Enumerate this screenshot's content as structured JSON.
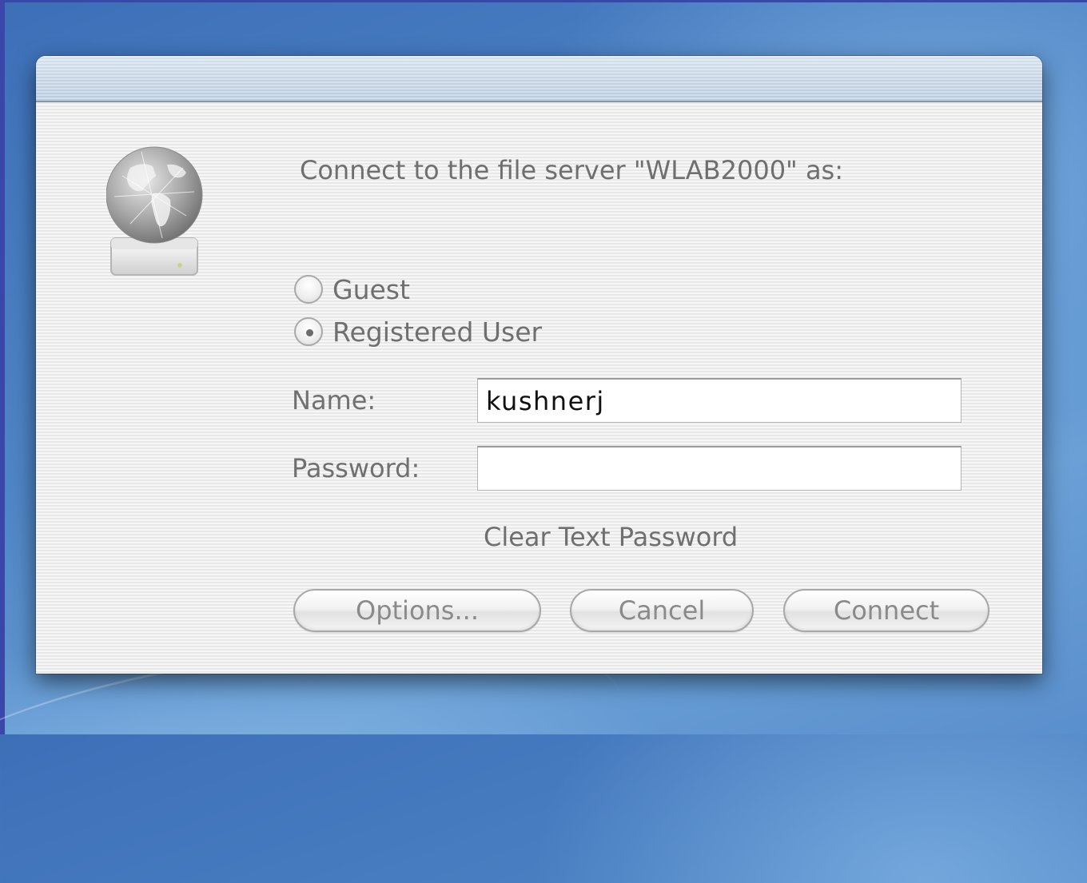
{
  "dialog": {
    "prompt": "Connect to the file server \"WLAB2000\" as:",
    "options": {
      "guest_label": "Guest",
      "registered_label": "Registered User",
      "selected": "Registered User"
    },
    "name_label": "Name:",
    "name_value": "kushnerj",
    "password_label": "Password:",
    "password_value": "",
    "security_note": "Clear Text Password",
    "buttons": {
      "options": "Options...",
      "cancel": "Cancel",
      "connect": "Connect"
    },
    "icon": "file-server-globe-icon"
  },
  "colors": {
    "desktop": "#4f86c6",
    "titlebar": "#c3d3e4",
    "dialog_bg": "#f1f1f1",
    "disabled_text": "#6f6f6f"
  }
}
